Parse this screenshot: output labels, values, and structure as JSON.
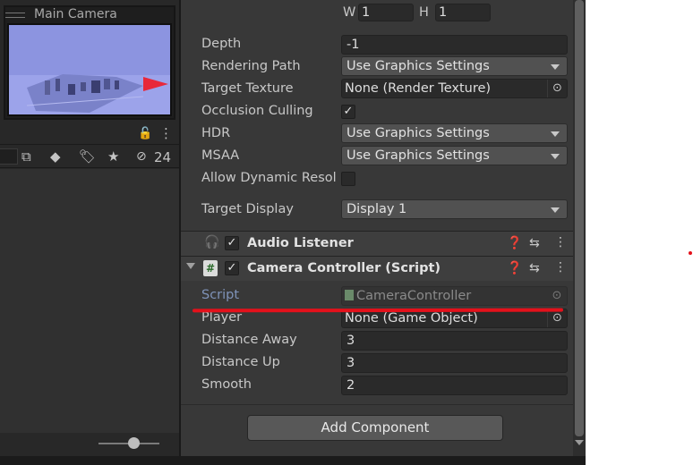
{
  "camera_preview": {
    "title": "Main Camera"
  },
  "left_panel": {
    "hidden_count": "24"
  },
  "viewport": {
    "size": {
      "w": "1",
      "h": "1"
    },
    "w_label": "W",
    "h_label": "H"
  },
  "camera": {
    "depth": {
      "label": "Depth",
      "value": "-1"
    },
    "rendering_path": {
      "label": "Rendering Path",
      "value": "Use Graphics Settings"
    },
    "target_texture": {
      "label": "Target Texture",
      "value": "None (Render Texture)"
    },
    "occlusion_culling": {
      "label": "Occlusion Culling",
      "checked": true
    },
    "hdr": {
      "label": "HDR",
      "value": "Use Graphics Settings"
    },
    "msaa": {
      "label": "MSAA",
      "value": "Use Graphics Settings"
    },
    "allow_dynamic_resolution": {
      "label": "Allow Dynamic Resol",
      "checked": false
    },
    "target_display": {
      "label": "Target Display",
      "value": "Display 1"
    }
  },
  "audio_listener": {
    "title": "Audio Listener",
    "enabled": true
  },
  "camera_controller": {
    "title": "Camera Controller (Script)",
    "enabled": true,
    "script": {
      "label": "Script",
      "value": "CameraController"
    },
    "player": {
      "label": "Player",
      "value": "None (Game Object)"
    },
    "distance_away": {
      "label": "Distance Away",
      "value": "3"
    },
    "distance_up": {
      "label": "Distance Up",
      "value": "3"
    },
    "smooth": {
      "label": "Smooth",
      "value": "2"
    }
  },
  "add_component_label": "Add Component",
  "colors": {
    "annotation_red": "#e4111b",
    "script_label": "#7f93b9",
    "preview_sky": "#8f97e3"
  }
}
